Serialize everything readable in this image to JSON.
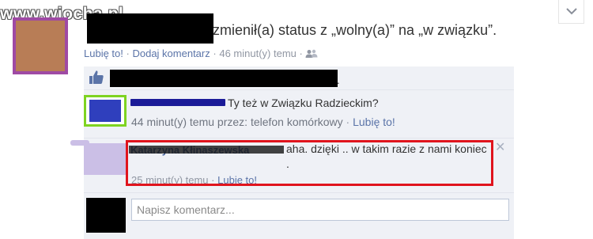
{
  "watermark": "www.wiocha.pl",
  "post": {
    "status_text": "zmienił(a) status z „wolny(a)” na „w związku”.",
    "like_label": "Lubię to!",
    "comment_label": "Dodaj komentarz",
    "time": "46 minut(y) temu",
    "separator": "·",
    "likes_suffix": "."
  },
  "comments": [
    {
      "text": "Ty też w Związku Radzieckim?",
      "time": "44 minut(y) temu przez: telefon komórkowy",
      "like_label": "Lubię to!"
    },
    {
      "author": "Katarzyna Kłinaszewska",
      "text": "aha. dzięki .. w takim razie z nami koniec .",
      "time": "25 minut(y) temu",
      "like_label": "Lubię to!",
      "close_glyph": "✕"
    }
  ],
  "composer": {
    "placeholder": "Napisz komentarz..."
  },
  "colors": {
    "link": "#5b74a8",
    "ufi_background": "#eff1f6",
    "highlight_border": "#e0141d",
    "avatar_border_purple": "#9f4aa4",
    "avatar_border_green": "#7ed321"
  }
}
